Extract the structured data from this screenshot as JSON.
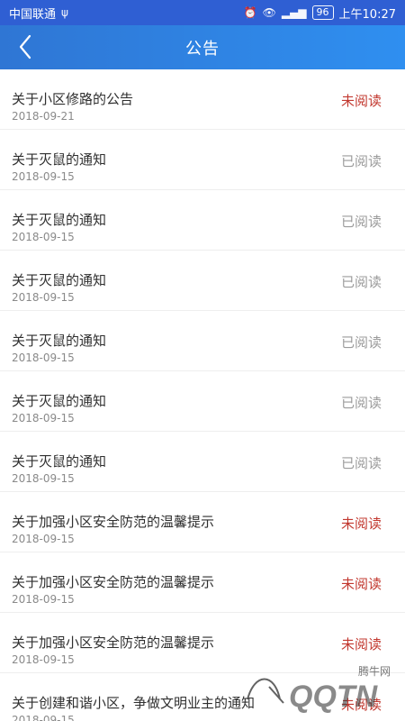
{
  "status_bar": {
    "carrier": "中国联通",
    "icons_left": [
      "usb-icon"
    ],
    "icons_right": [
      "alarm-icon",
      "eye-icon",
      "signal-4g-icon"
    ],
    "battery_level": "96",
    "time": "上午10:27"
  },
  "header": {
    "title": "公告"
  },
  "announcements": [
    {
      "title": "关于小区修路的公告",
      "date": "2018-09-21",
      "status": "未阅读",
      "status_type": "unread"
    },
    {
      "title": "关于灭鼠的通知",
      "date": "2018-09-15",
      "status": "已阅读",
      "status_type": "read"
    },
    {
      "title": "关于灭鼠的通知",
      "date": "2018-09-15",
      "status": "已阅读",
      "status_type": "read"
    },
    {
      "title": "关于灭鼠的通知",
      "date": "2018-09-15",
      "status": "已阅读",
      "status_type": "read"
    },
    {
      "title": "关于灭鼠的通知",
      "date": "2018-09-15",
      "status": "已阅读",
      "status_type": "read"
    },
    {
      "title": "关于灭鼠的通知",
      "date": "2018-09-15",
      "status": "已阅读",
      "status_type": "read"
    },
    {
      "title": "关于灭鼠的通知",
      "date": "2018-09-15",
      "status": "已阅读",
      "status_type": "read"
    },
    {
      "title": "关于加强小区安全防范的温馨提示",
      "date": "2018-09-15",
      "status": "未阅读",
      "status_type": "unread"
    },
    {
      "title": "关于加强小区安全防范的温馨提示",
      "date": "2018-09-15",
      "status": "未阅读",
      "status_type": "unread"
    },
    {
      "title": "关于加强小区安全防范的温馨提示",
      "date": "2018-09-15",
      "status": "未阅读",
      "status_type": "unread"
    },
    {
      "title": "关于创建和谐小区，争做文明业主的通知",
      "date": "2018-09-15",
      "status": "未阅读",
      "status_type": "unread"
    }
  ],
  "watermark": {
    "cn": "腾牛网",
    "en": "QQTN"
  },
  "colors": {
    "status_bar_bg": "#2f5fd3",
    "app_bar_bg": "#2f8ff0",
    "unread": "#c2382f",
    "read": "#9b9b9b"
  }
}
